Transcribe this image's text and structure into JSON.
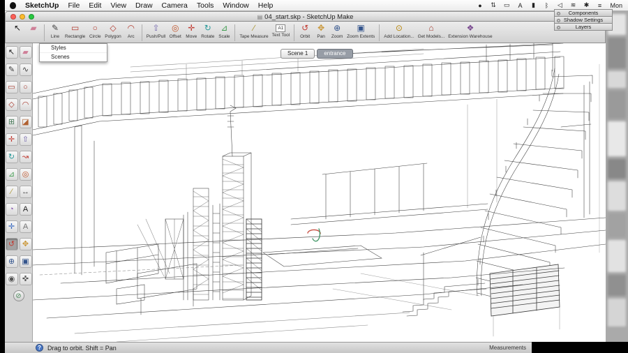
{
  "menubar": {
    "items": [
      "SketchUp",
      "File",
      "Edit",
      "View",
      "Draw",
      "Camera",
      "Tools",
      "Window",
      "Help"
    ],
    "status_icons": [
      {
        "name": "dot-icon",
        "glyph": "●"
      },
      {
        "name": "sync-icon",
        "glyph": "⇅"
      },
      {
        "name": "display-icon",
        "glyph": "▭"
      },
      {
        "name": "input-source-icon",
        "glyph": "A"
      },
      {
        "name": "battery-icon",
        "glyph": "▮"
      },
      {
        "name": "bluetooth-icon",
        "glyph": "ᛒ"
      },
      {
        "name": "volume-icon",
        "glyph": "◁"
      },
      {
        "name": "wifi-icon",
        "glyph": "≋"
      },
      {
        "name": "asterisk-icon",
        "glyph": "✱"
      },
      {
        "name": "list-icon",
        "glyph": "≡"
      }
    ],
    "clock": "Mon"
  },
  "window": {
    "title": "04_start.skp - SketchUp Make",
    "doc_icon": "▤"
  },
  "toolbar": {
    "tools": [
      {
        "name": "select",
        "label": "",
        "glyph": "↖",
        "color": "#1a1a1a"
      },
      {
        "name": "eraser",
        "label": "",
        "glyph": "▰",
        "color": "#cf7f98"
      },
      {
        "name": "line",
        "label": "Line",
        "glyph": "✎",
        "color": "#444444"
      },
      {
        "name": "rectangle",
        "label": "Rectangle",
        "glyph": "▭",
        "color": "#b23b2e"
      },
      {
        "name": "circle",
        "label": "Circle",
        "glyph": "○",
        "color": "#b23b2e"
      },
      {
        "name": "polygon",
        "label": "Polygon",
        "glyph": "◇",
        "color": "#b23b2e"
      },
      {
        "name": "arc",
        "label": "Arc",
        "glyph": "◠",
        "color": "#b23b2e"
      },
      {
        "name": "push-pull",
        "label": "Push/Pull",
        "glyph": "⇧",
        "color": "#7568ad"
      },
      {
        "name": "offset",
        "label": "Offset",
        "glyph": "◎",
        "color": "#c1562c"
      },
      {
        "name": "move",
        "label": "Move",
        "glyph": "✛",
        "color": "#c23b32"
      },
      {
        "name": "rotate",
        "label": "Rotate",
        "glyph": "↻",
        "color": "#2a9a9a"
      },
      {
        "name": "scale",
        "label": "Scale",
        "glyph": "⊿",
        "color": "#3f9d4f"
      },
      {
        "name": "tape-measure",
        "label": "Tape Measure",
        "glyph": "∕",
        "color": "#a8922e"
      },
      {
        "name": "text-tool",
        "label": "Text Tool",
        "glyph": "A1",
        "color": "#333333"
      },
      {
        "name": "orbit",
        "label": "Orbit",
        "glyph": "↺",
        "color": "#c23b32"
      },
      {
        "name": "pan",
        "label": "Pan",
        "glyph": "✥",
        "color": "#c99636"
      },
      {
        "name": "zoom",
        "label": "Zoom",
        "glyph": "⊕",
        "color": "#33548c"
      },
      {
        "name": "zoom-extents",
        "label": "Zoom Extents",
        "glyph": "▣",
        "color": "#33548c"
      },
      {
        "name": "add-location",
        "label": "Add Location...",
        "glyph": "⊙",
        "color": "#b8860b"
      },
      {
        "name": "get-models",
        "label": "Get Models...",
        "glyph": "⌂",
        "color": "#a33b2e"
      },
      {
        "name": "extension-warehouse",
        "label": "Extension Warehouse",
        "glyph": "❖",
        "color": "#7a4a90"
      }
    ]
  },
  "popup": {
    "items": [
      "Styles",
      "Scenes"
    ]
  },
  "scene_tabs": [
    {
      "label": "Scene 1",
      "active": false
    },
    {
      "label": "entrance",
      "active": true
    }
  ],
  "palette": {
    "tools": [
      {
        "name": "select",
        "glyph": "↖",
        "color": "#1a1a1a"
      },
      {
        "name": "eraser",
        "glyph": "▰",
        "color": "#cf7f98"
      },
      {
        "name": "line",
        "glyph": "✎",
        "color": "#3a3a3a"
      },
      {
        "name": "freehand",
        "glyph": "∿",
        "color": "#3a3a3a"
      },
      {
        "name": "rectangle",
        "glyph": "▭",
        "color": "#a83a2e"
      },
      {
        "name": "circle",
        "glyph": "○",
        "color": "#a83a2e"
      },
      {
        "name": "polygon",
        "glyph": "◇",
        "color": "#a83a2e"
      },
      {
        "name": "arc",
        "glyph": "◠",
        "color": "#a83a2e"
      },
      {
        "name": "make-component",
        "glyph": "⊞",
        "color": "#4a7a5a"
      },
      {
        "name": "paint-bucket",
        "glyph": "◪",
        "color": "#b06030"
      },
      {
        "name": "move",
        "glyph": "✛",
        "color": "#c23b32"
      },
      {
        "name": "push-pull",
        "glyph": "⇧",
        "color": "#7568ad"
      },
      {
        "name": "rotate",
        "glyph": "↻",
        "color": "#2a9a9a"
      },
      {
        "name": "follow-me",
        "glyph": "↝",
        "color": "#c23b32"
      },
      {
        "name": "scale",
        "glyph": "⊿",
        "color": "#3f9d4f"
      },
      {
        "name": "offset",
        "glyph": "◎",
        "color": "#c1562c"
      },
      {
        "name": "tape-measure",
        "glyph": "∕",
        "color": "#a8922e"
      },
      {
        "name": "dimension",
        "glyph": "↔",
        "color": "#555555"
      },
      {
        "name": "protractor",
        "glyph": "◔",
        "color": "#8a5ab0"
      },
      {
        "name": "text",
        "glyph": "A",
        "color": "#222222"
      },
      {
        "name": "axes",
        "glyph": "✛",
        "color": "#3567c0"
      },
      {
        "name": "3d-text",
        "glyph": "A",
        "color": "#737373"
      },
      {
        "name": "orbit",
        "glyph": "↺",
        "color": "#c23b32",
        "active": true
      },
      {
        "name": "pan",
        "glyph": "✥",
        "color": "#c99636"
      },
      {
        "name": "zoom",
        "glyph": "⊕",
        "color": "#33548c"
      },
      {
        "name": "zoom-extents",
        "glyph": "▣",
        "color": "#33548c"
      },
      {
        "name": "position-camera",
        "glyph": "◉",
        "color": "#555555"
      },
      {
        "name": "walk",
        "glyph": "✜",
        "color": "#555555"
      },
      {
        "name": "section-plane",
        "glyph": "⊘",
        "color": "#4a8a5a"
      }
    ]
  },
  "panels": [
    {
      "title": "Components"
    },
    {
      "title": "Shadow Settings"
    },
    {
      "title": "Layers"
    }
  ],
  "statusbar": {
    "help": "?",
    "hint": "Drag to orbit.  Shift = Pan",
    "measurements": "Measurements"
  }
}
